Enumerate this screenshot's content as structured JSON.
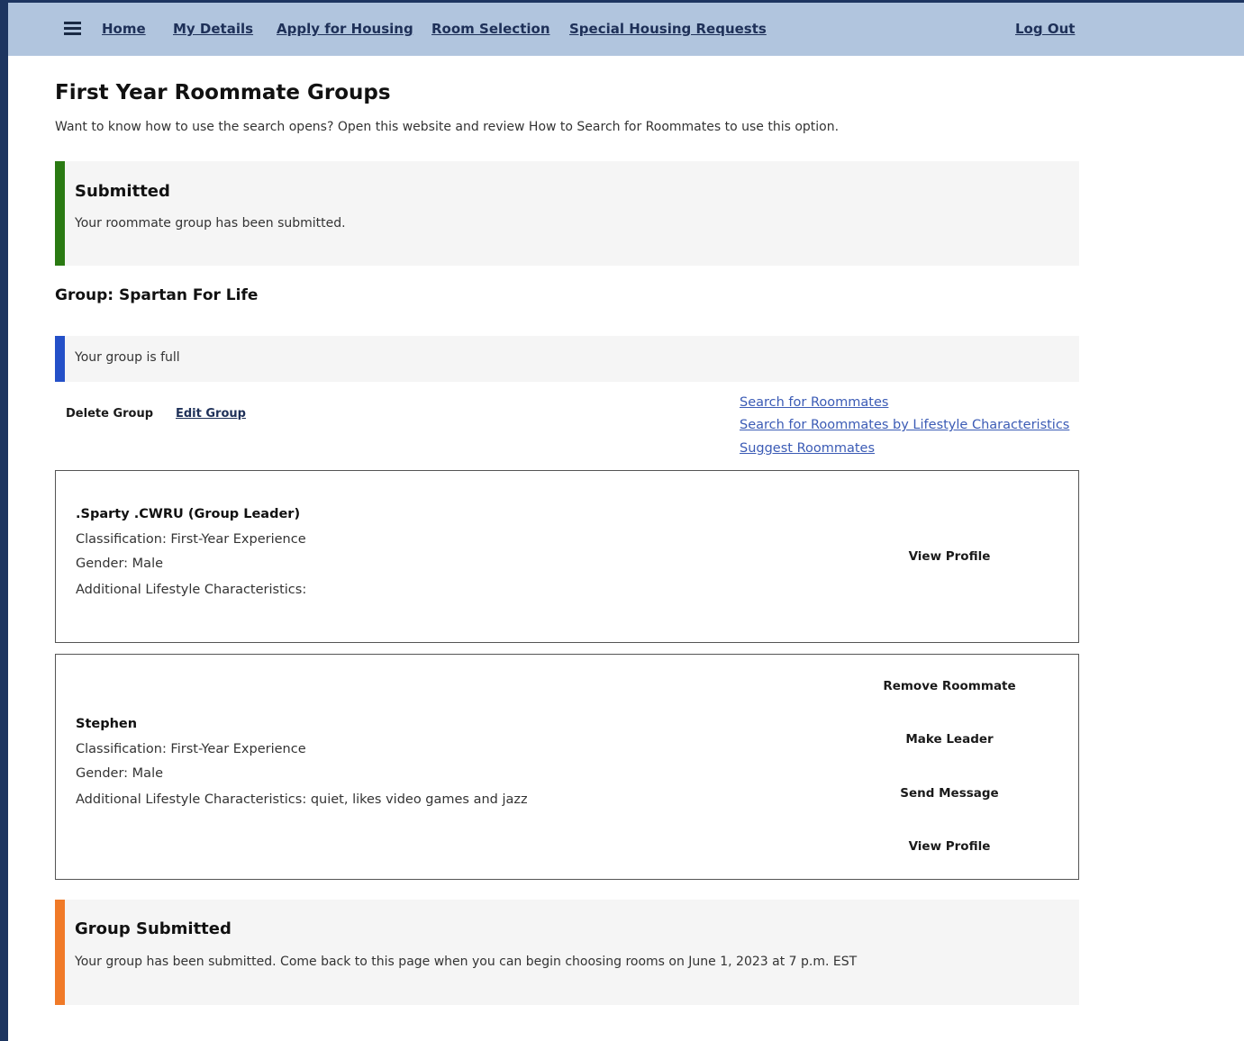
{
  "nav": {
    "items": [
      "Home",
      "My Details",
      "Apply for Housing",
      "Room Selection",
      "Special Housing Requests"
    ],
    "logout": "Log Out"
  },
  "page": {
    "title": "First Year Roommate Groups",
    "intro": "Want to know how to use the search opens? Open this website and review How to Search for Roommates to use this option."
  },
  "submitted_alert": {
    "title": "Submitted",
    "text": "Your roommate group has been submitted.",
    "color": "#2a7a12"
  },
  "group": {
    "title": "Group: Spartan For Life",
    "status": "Your group is full",
    "status_color": "#2450c8",
    "actions": {
      "delete": "Delete Group",
      "edit": "Edit Group"
    },
    "links": [
      "Search for Roommates",
      "Search for Roommates by Lifestyle Characteristics",
      "Suggest Roommates"
    ]
  },
  "members": [
    {
      "name": ".Sparty .CWRU (Group Leader)",
      "classification": "Classification: First-Year Experience",
      "gender": "Gender: Male",
      "lifestyle": "Additional Lifestyle Characteristics:",
      "buttons": [
        "View Profile"
      ]
    },
    {
      "name": "Stephen",
      "classification": "Classification: First-Year Experience",
      "gender": "Gender: Male",
      "lifestyle": "Additional Lifestyle Characteristics: quiet, likes video games and jazz",
      "buttons": [
        "Remove Roommate",
        "Make Leader",
        "Send Message",
        "View Profile"
      ]
    }
  ],
  "final_alert": {
    "title": "Group Submitted",
    "text": "Your group has been submitted. Come back to this page when you can begin choosing rooms on June 1, 2023 at 7 p.m. EST",
    "color": "#f07a28"
  }
}
